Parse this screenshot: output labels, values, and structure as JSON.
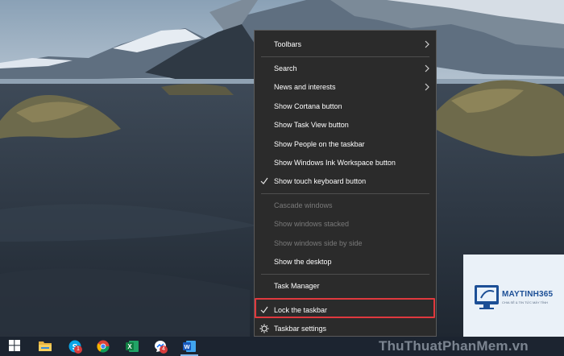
{
  "context_menu": {
    "items": [
      {
        "label": "Toolbars",
        "submenu": true,
        "checked": false,
        "enabled": true
      },
      {
        "label": "Search",
        "submenu": true,
        "checked": false,
        "enabled": true
      },
      {
        "label": "News and interests",
        "submenu": true,
        "checked": false,
        "enabled": true
      },
      {
        "label": "Show Cortana button",
        "submenu": false,
        "checked": false,
        "enabled": true
      },
      {
        "label": "Show Task View button",
        "submenu": false,
        "checked": false,
        "enabled": true
      },
      {
        "label": "Show People on the taskbar",
        "submenu": false,
        "checked": false,
        "enabled": true
      },
      {
        "label": "Show Windows Ink Workspace button",
        "submenu": false,
        "checked": false,
        "enabled": true
      },
      {
        "label": "Show touch keyboard button",
        "submenu": false,
        "checked": true,
        "enabled": true
      },
      {
        "label": "Cascade windows",
        "submenu": false,
        "checked": false,
        "enabled": false
      },
      {
        "label": "Show windows stacked",
        "submenu": false,
        "checked": false,
        "enabled": false
      },
      {
        "label": "Show windows side by side",
        "submenu": false,
        "checked": false,
        "enabled": false
      },
      {
        "label": "Show the desktop",
        "submenu": false,
        "checked": false,
        "enabled": true
      },
      {
        "label": "Task Manager",
        "submenu": false,
        "checked": false,
        "enabled": true
      },
      {
        "label": "Lock the taskbar",
        "submenu": false,
        "checked": true,
        "enabled": true,
        "highlighted": true
      },
      {
        "label": "Taskbar settings",
        "submenu": false,
        "checked": false,
        "enabled": true,
        "icon": "gear-icon"
      }
    ],
    "highlight_color": "#e0393e"
  },
  "taskbar": {
    "icons": [
      {
        "name": "windows-start-icon"
      },
      {
        "name": "file-explorer-icon"
      },
      {
        "name": "skype-icon",
        "badge": "1"
      },
      {
        "name": "chrome-icon"
      },
      {
        "name": "excel-icon"
      },
      {
        "name": "messenger-icon",
        "badge": "4"
      },
      {
        "name": "word-icon"
      }
    ]
  },
  "watermark": {
    "brand": "MAYTINH365",
    "tagline": "CHIA SẺ & TIN TỨC MÁY TÍNH",
    "site": "ThuThuatPhanMem.vn"
  }
}
